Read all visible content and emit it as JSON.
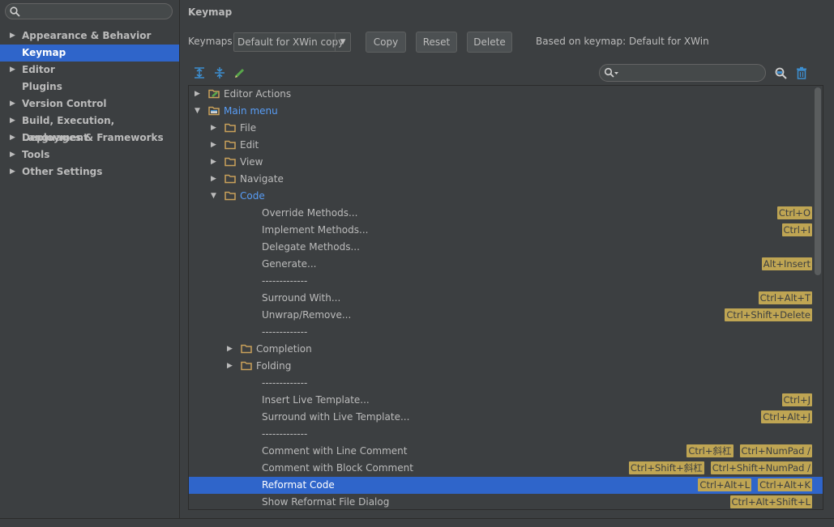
{
  "sidebar": {
    "search_placeholder": "",
    "items": [
      {
        "label": "Appearance & Behavior",
        "expandable": true,
        "selected": false
      },
      {
        "label": "Keymap",
        "expandable": false,
        "selected": true
      },
      {
        "label": "Editor",
        "expandable": true,
        "selected": false
      },
      {
        "label": "Plugins",
        "expandable": false,
        "selected": false
      },
      {
        "label": "Version Control",
        "expandable": true,
        "selected": false
      },
      {
        "label": "Build, Execution, Deployment",
        "expandable": true,
        "selected": false
      },
      {
        "label": "Languages & Frameworks",
        "expandable": true,
        "selected": false
      },
      {
        "label": "Tools",
        "expandable": true,
        "selected": false
      },
      {
        "label": "Other Settings",
        "expandable": true,
        "selected": false
      }
    ]
  },
  "header": {
    "title": "Keymap",
    "keymaps_label": "Keymaps:",
    "keymap_selected": "Default for XWin copy",
    "copy_label": "Copy",
    "reset_label": "Reset",
    "delete_label": "Delete",
    "based_on": "Based on keymap: Default for XWin"
  },
  "filter": {
    "placeholder": ""
  },
  "colors": {
    "accent": "#2f65ca",
    "link": "#589df6",
    "shortcut_bg": "#bfa553",
    "folder": "#c9a15a"
  },
  "tree": [
    {
      "level": 0,
      "toggle": "collapsed",
      "icon": "editor-actions-icon",
      "label": "Editor Actions",
      "shortcuts": []
    },
    {
      "level": 0,
      "toggle": "expanded",
      "icon": "main-menu-icon",
      "label": "Main menu",
      "blue": true,
      "shortcuts": []
    },
    {
      "level": 1,
      "toggle": "collapsed",
      "icon": "folder-icon",
      "label": "File",
      "shortcuts": []
    },
    {
      "level": 1,
      "toggle": "collapsed",
      "icon": "folder-icon",
      "label": "Edit",
      "shortcuts": []
    },
    {
      "level": 1,
      "toggle": "collapsed",
      "icon": "folder-icon",
      "label": "View",
      "shortcuts": []
    },
    {
      "level": 1,
      "toggle": "collapsed",
      "icon": "folder-icon",
      "label": "Navigate",
      "shortcuts": []
    },
    {
      "level": 1,
      "toggle": "expanded",
      "icon": "folder-icon",
      "label": "Code",
      "blue": true,
      "shortcuts": []
    },
    {
      "level": 2,
      "toggle": "none",
      "icon": "",
      "label": "Override Methods...",
      "shortcuts": [
        "Ctrl+O"
      ]
    },
    {
      "level": 2,
      "toggle": "none",
      "icon": "",
      "label": "Implement Methods...",
      "shortcuts": [
        "Ctrl+I"
      ]
    },
    {
      "level": 2,
      "toggle": "none",
      "icon": "",
      "label": "Delegate Methods...",
      "shortcuts": []
    },
    {
      "level": 2,
      "toggle": "none",
      "icon": "",
      "label": "Generate...",
      "shortcuts": [
        "Alt+Insert"
      ]
    },
    {
      "level": 2,
      "toggle": "none",
      "icon": "",
      "label": "-------------",
      "shortcuts": []
    },
    {
      "level": 2,
      "toggle": "none",
      "icon": "",
      "label": "Surround With...",
      "shortcuts": [
        "Ctrl+Alt+T"
      ]
    },
    {
      "level": 2,
      "toggle": "none",
      "icon": "",
      "label": "Unwrap/Remove...",
      "shortcuts": [
        "Ctrl+Shift+Delete"
      ]
    },
    {
      "level": 2,
      "toggle": "none",
      "icon": "",
      "label": "-------------",
      "shortcuts": []
    },
    {
      "level": 2,
      "toggle": "collapsed",
      "icon": "folder-icon",
      "label": "Completion",
      "shortcuts": []
    },
    {
      "level": 2,
      "toggle": "collapsed",
      "icon": "folder-icon",
      "label": "Folding",
      "shortcuts": []
    },
    {
      "level": 2,
      "toggle": "none",
      "icon": "",
      "label": "-------------",
      "shortcuts": []
    },
    {
      "level": 2,
      "toggle": "none",
      "icon": "",
      "label": "Insert Live Template...",
      "shortcuts": [
        "Ctrl+J"
      ]
    },
    {
      "level": 2,
      "toggle": "none",
      "icon": "",
      "label": "Surround with Live Template...",
      "shortcuts": [
        "Ctrl+Alt+J"
      ]
    },
    {
      "level": 2,
      "toggle": "none",
      "icon": "",
      "label": "-------------",
      "shortcuts": []
    },
    {
      "level": 2,
      "toggle": "none",
      "icon": "",
      "label": "Comment with Line Comment",
      "shortcuts": [
        "Ctrl+斜杠",
        "Ctrl+NumPad /"
      ]
    },
    {
      "level": 2,
      "toggle": "none",
      "icon": "",
      "label": "Comment with Block Comment",
      "shortcuts": [
        "Ctrl+Shift+斜杠",
        "Ctrl+Shift+NumPad /"
      ]
    },
    {
      "level": 2,
      "toggle": "none",
      "icon": "",
      "label": "Reformat Code",
      "selected": true,
      "shortcuts": [
        "Ctrl+Alt+L",
        "Ctrl+Alt+K"
      ]
    },
    {
      "level": 2,
      "toggle": "none",
      "icon": "",
      "label": "Show Reformat File Dialog",
      "shortcuts": [
        "Ctrl+Alt+Shift+L"
      ]
    }
  ]
}
